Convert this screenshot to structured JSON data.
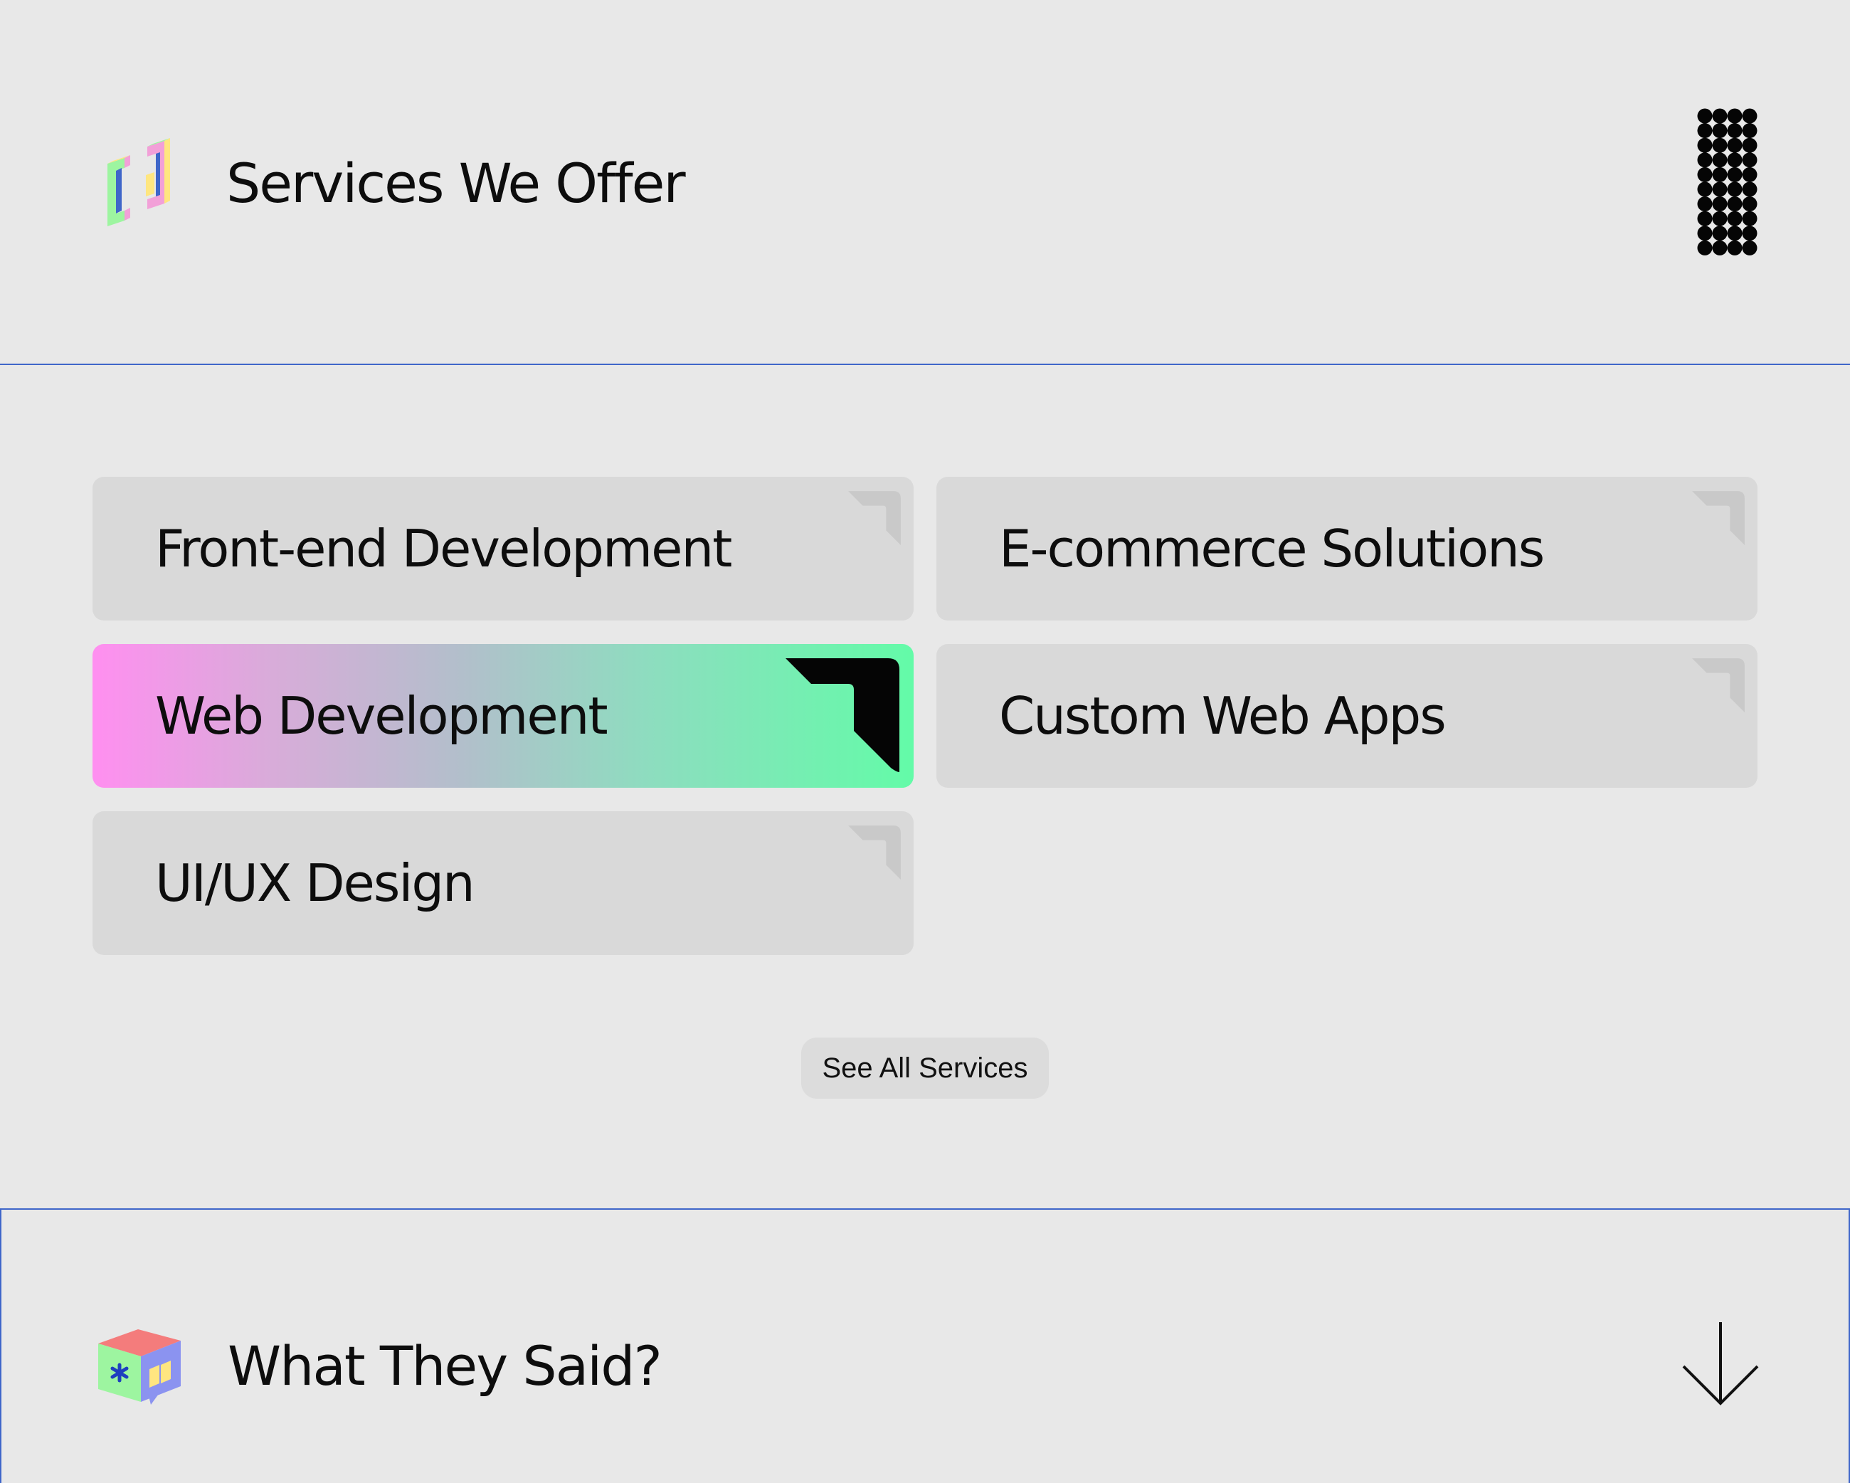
{
  "services_section": {
    "title": "Services We Offer",
    "logo_icon": "bracket-cube-icon",
    "menu_icon": "dots-grid-menu-icon"
  },
  "services": [
    {
      "id": "frontend",
      "label": "Front-end Development",
      "active": false
    },
    {
      "id": "ecommerce",
      "label": "E-commerce Solutions",
      "active": false
    },
    {
      "id": "webdev",
      "label": "Web Development",
      "active": true
    },
    {
      "id": "customapps",
      "label": "Custom Web Apps",
      "active": false
    },
    {
      "id": "uiux",
      "label": "UI/UX Design",
      "active": false
    }
  ],
  "see_all_button": {
    "label": "See All Services"
  },
  "testimonials_section": {
    "title": "What They Said?",
    "logo_icon": "chat-cube-icon",
    "arrow_icon": "arrow-down-icon"
  },
  "colors": {
    "background": "#e8e8e8",
    "card": "#d9d9d9",
    "divider": "#3f66c9",
    "active_gradient_start": "#ff8ff0",
    "active_gradient_end": "#63fba8",
    "text": "#0d0d0d"
  }
}
